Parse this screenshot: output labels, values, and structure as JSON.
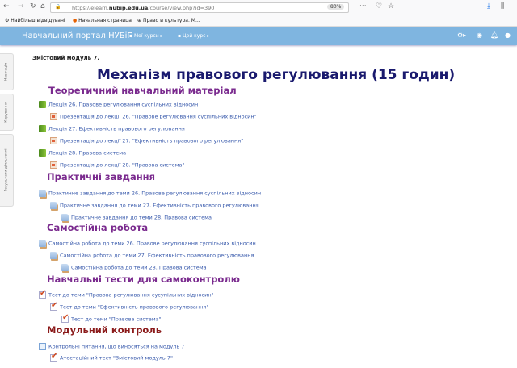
{
  "browser": {
    "url_prefix": "https://elearn.",
    "url_domain": "nubip.edu.ua",
    "url_path": "/course/view.php?id=390",
    "zoom": "80%",
    "bookmarks": [
      "Найбільш відвідувані",
      "Начальная страница",
      "Право и культура. М..."
    ]
  },
  "navbar": {
    "brand": "Навчальний портал НУБіП",
    "my_courses": "Мої курси",
    "this_course": "Цей курс"
  },
  "side_tabs": [
    "Навігація",
    "Керування",
    "Результати діяльності"
  ],
  "module_label": "Змістовий модуль 7.",
  "title": "Механізм правового регулювання (15 годин)",
  "sections": [
    {
      "heading": "Теоретичний навчальний матеріал",
      "items": [
        "Лекція 26. Правове регулювання суспільних відносин",
        "Презентація до лекції 26. \"Правове регулювання суспільних відносин\"",
        "Лекція 27. Ефективність правового регулювання",
        "Презентація до лекції 27. \"Ефективність правового регулювання\"",
        "Лекція 28. Правова система",
        "Презентація до лекції 28. \"Правова система\""
      ]
    },
    {
      "heading": "Практичні завдання",
      "items": [
        "Практичне завдання до теми 26. Правове регулювання суспільних відносин",
        "Практичне завдання до теми 27. Ефективність правового регулювання",
        "Практичне завдання до теми 28. Правова система"
      ]
    },
    {
      "heading": "Самостійна робота",
      "items": [
        "Самостійна робота до теми 26. Правове регулювання суспільних відносин",
        "Самостійна робота до теми 27. Ефективність правового регулювання",
        "Самостійна робота до теми 28. Правова система"
      ]
    },
    {
      "heading": "Навчальні тести для самоконтролю",
      "items": [
        "Тест до теми \"Правова регулювання сусупільних відносин\"",
        "Тест до теми \"Ефективність правового регулювання\"",
        "Тест до теми \"Правова система\""
      ]
    },
    {
      "heading": "Модульний контроль",
      "items": [
        "Контрольні питання, що виносяться на модуль 7",
        "Атестаційний тест \"Змістовий модуль 7\""
      ]
    }
  ],
  "colors": {
    "navbar": "#7fb5e0",
    "title": "#1a1a6e",
    "heading": "#7a2a8e",
    "heading_red": "#8b1a1a",
    "link": "#3b5cad"
  }
}
